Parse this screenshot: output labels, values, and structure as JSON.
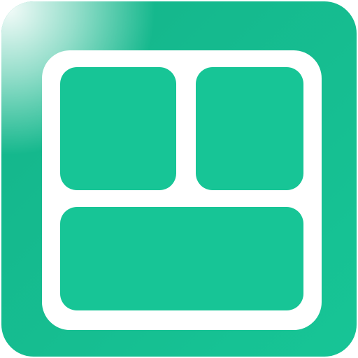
{
  "icon": {
    "name": "dashboard-layout-icon",
    "colors": {
      "tile": "#17c596",
      "tile_dark": "#14b48a",
      "highlight": "#ffffff",
      "frame": "#ffffff"
    },
    "panes": [
      {
        "id": "top-left-pane"
      },
      {
        "id": "top-right-pane"
      },
      {
        "id": "bottom-pane"
      }
    ]
  }
}
